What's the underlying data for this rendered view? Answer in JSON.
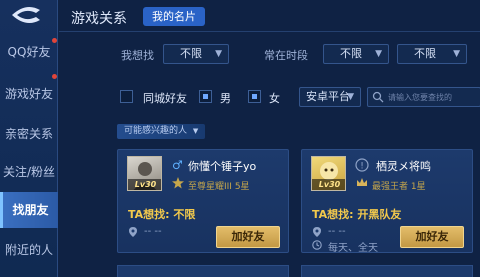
{
  "sidebar": {
    "items": [
      {
        "label": "QQ好友",
        "badge": true
      },
      {
        "label": "游戏好友",
        "badge": false
      },
      {
        "label": "亲密关系",
        "badge": false
      },
      {
        "label": "关注/粉丝",
        "badge": false
      },
      {
        "label": "找朋友",
        "badge": false,
        "active": true
      },
      {
        "label": "附近的人",
        "badge": false
      }
    ]
  },
  "header": {
    "title": "游戏关系",
    "card_button": "我的名片"
  },
  "filters": {
    "want_label": "我想找",
    "want_value": "不限",
    "time_label": "常在时段",
    "time_value": "不限",
    "time_value2": "不限",
    "same_city_label": "同城好友",
    "male_label": "男",
    "female_label": "女",
    "platform_value": "安卓平台",
    "search_placeholder": "请输入您要查找的"
  },
  "section": {
    "tag_label": "可能感兴趣的人"
  },
  "cards": [
    {
      "name": "你懂个锤子yo",
      "gender": "male",
      "level": "Lv30",
      "rank": "至尊星耀III 5星",
      "want": "TA想找: 不限",
      "location": "-- --",
      "time": "-- --",
      "add_label": "加好友"
    },
    {
      "name": "栖灵メ将鸣",
      "gender": "unknown",
      "level": "Lv30",
      "rank": "最强王者 1星",
      "want": "TA想找: 开黑队友",
      "location": "-- --",
      "time": "每天、全天",
      "add_label": "加好友"
    }
  ],
  "colors": {
    "accent": "#2a63c7",
    "add_button": "#d4ac58",
    "want_text": "#f2c94c",
    "rank_text": "#c5a64b"
  }
}
